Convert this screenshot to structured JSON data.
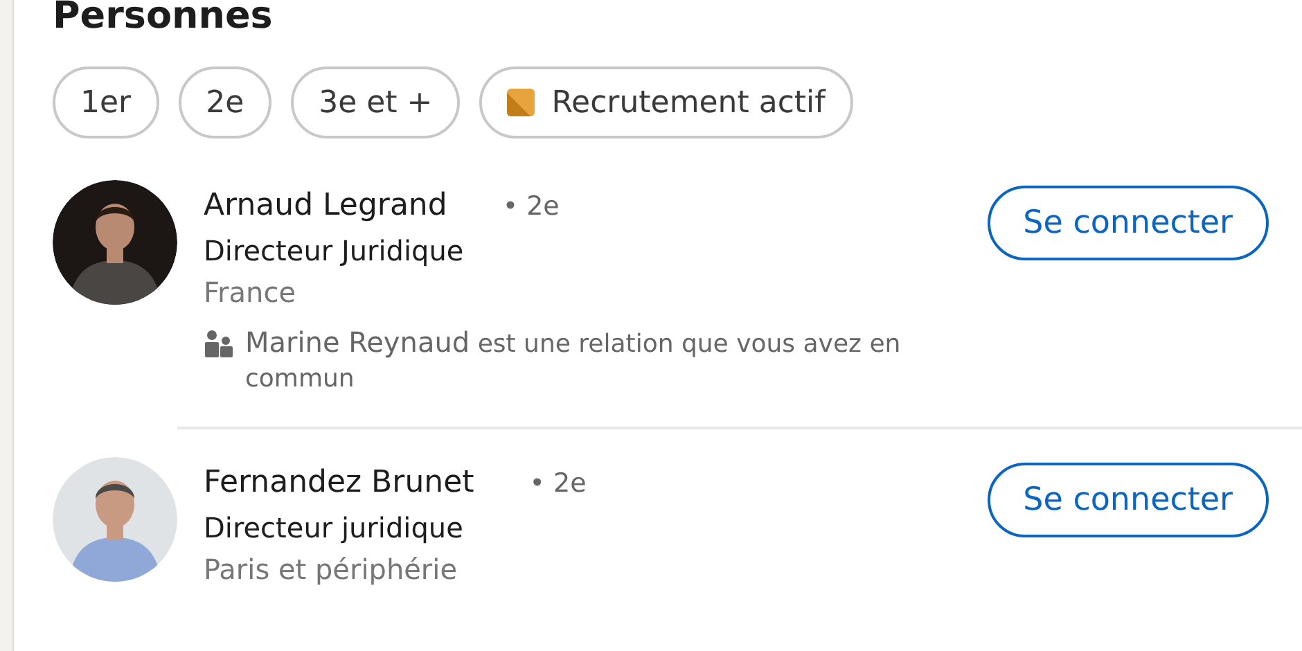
{
  "section": {
    "title": "Personnes"
  },
  "filters": [
    {
      "label": "1er",
      "kind": "plain"
    },
    {
      "label": "2e",
      "kind": "plain"
    },
    {
      "label": "3e et +",
      "kind": "plain"
    },
    {
      "label": "Recrutement actif",
      "kind": "badge"
    }
  ],
  "people": [
    {
      "name": "Arnaud Legrand",
      "degree": "• 2e",
      "headline": "Directeur Juridique",
      "location": "France",
      "mutual": {
        "name": "Marine Reynaud",
        "text": "est une relation que vous avez en commun"
      },
      "button": "Se connecter"
    },
    {
      "name": "Fernandez Brunet",
      "degree": "• 2e",
      "headline": "Directeur juridique",
      "location": "Paris et périphérie",
      "button": "Se connecter"
    }
  ]
}
